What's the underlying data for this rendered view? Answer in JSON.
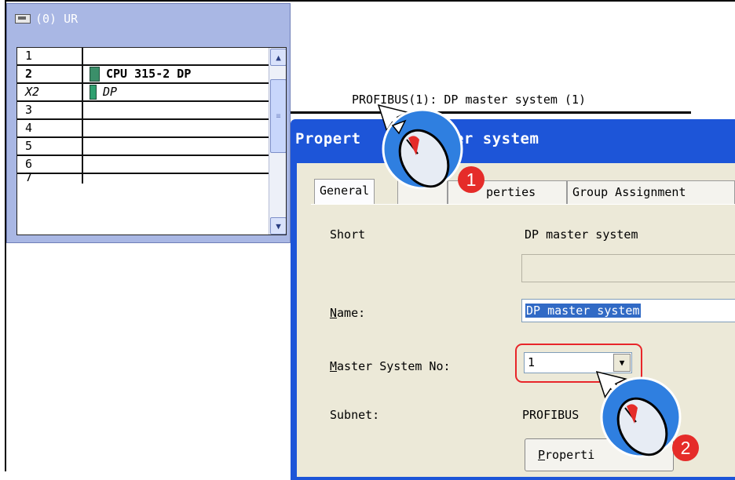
{
  "rack": {
    "title": "(0) UR",
    "rows": [
      {
        "slot": "1",
        "module": ""
      },
      {
        "slot": "2",
        "module": "CPU 315-2 DP"
      },
      {
        "slot": "X2",
        "module": "DP"
      },
      {
        "slot": "3",
        "module": ""
      },
      {
        "slot": "4",
        "module": ""
      },
      {
        "slot": "5",
        "module": ""
      },
      {
        "slot": "6",
        "module": ""
      },
      {
        "slot": "7",
        "module": ""
      }
    ],
    "scroll_up_icon": "arrow-up-icon",
    "scroll_down_icon": "arrow-down-icon"
  },
  "network": {
    "label": "PROFIBUS(1): DP master system (1)"
  },
  "dialog": {
    "title": "Propert   DP master system",
    "tabs": [
      "General",
      "",
      "perties",
      "Group Assignment"
    ],
    "short_label": "Short",
    "short_value": "DP master system",
    "name_label": "Name:",
    "name_value": "DP master system",
    "master_no_label": "Master System No:",
    "master_no_value": "1",
    "subnet_label": "Subnet:",
    "subnet_value": "PROFIBUS",
    "properties_button": "Properti"
  },
  "annotations": {
    "step1": "1",
    "step2": "2",
    "accent_color": "#e52c29",
    "cursor_color": "#2f7fe0"
  }
}
